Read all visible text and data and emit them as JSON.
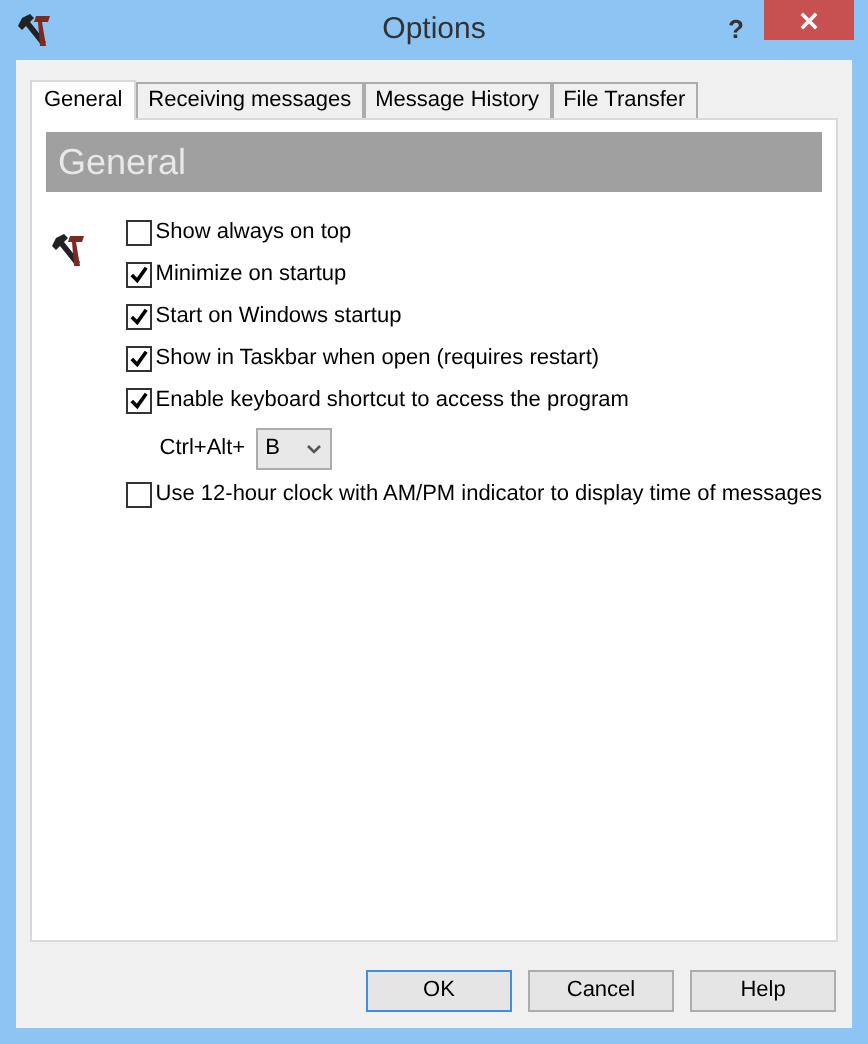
{
  "window": {
    "title": "Options",
    "help_button": "?"
  },
  "tabs": [
    {
      "label": "General",
      "selected": true
    },
    {
      "label": "Receiving messages",
      "selected": false
    },
    {
      "label": "Message History",
      "selected": false
    },
    {
      "label": "File Transfer",
      "selected": false
    }
  ],
  "section_title": "General",
  "options": [
    {
      "kind": "checkbox",
      "label": "Show always on top",
      "checked": false
    },
    {
      "kind": "checkbox",
      "label": "Minimize on startup",
      "checked": true
    },
    {
      "kind": "checkbox",
      "label": "Start on Windows startup",
      "checked": true
    },
    {
      "kind": "checkbox",
      "label": "Show in Taskbar when open (requires restart)",
      "checked": true
    },
    {
      "kind": "checkbox",
      "label": "Enable keyboard shortcut to access the program",
      "checked": true
    },
    {
      "kind": "shortcut",
      "label": "Ctrl+Alt+",
      "value": "B"
    },
    {
      "kind": "checkbox",
      "label": "Use 12-hour clock with AM/PM indicator to display time of messages",
      "checked": false
    }
  ],
  "buttons": [
    {
      "label": "OK",
      "selected": true
    },
    {
      "label": "Cancel",
      "selected": false
    },
    {
      "label": "Help",
      "selected": false
    }
  ]
}
